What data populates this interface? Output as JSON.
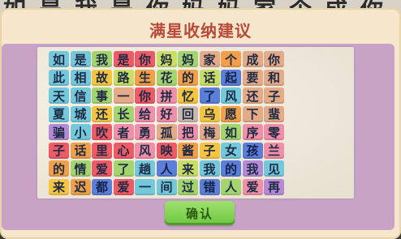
{
  "background": {
    "row_text": "如是我是你妈妈家个成你"
  },
  "dialog": {
    "title": "满星收纳建议",
    "confirm_label": "确认"
  },
  "colors": {
    "dialog_bg": "#f6e7cc",
    "title": "#b84a3a",
    "panel": "#c8a3c6",
    "button": "#7fd14d"
  },
  "board": {
    "rows": [
      [
        [
          "如",
          "cyan"
        ],
        [
          "是",
          "cyan"
        ],
        [
          "我",
          "green"
        ],
        [
          "是",
          "red"
        ],
        [
          "你",
          "red"
        ],
        [
          "妈",
          "lime"
        ],
        [
          "妈",
          "green"
        ],
        [
          "家",
          "tan"
        ],
        [
          "个",
          "orange"
        ],
        [
          "成",
          "tan"
        ],
        [
          "你",
          "tan"
        ]
      ],
      [
        [
          "此",
          "cyan"
        ],
        [
          "相",
          "cyan"
        ],
        [
          "故",
          "yellow"
        ],
        [
          "路",
          "lime"
        ],
        [
          "生",
          "orange"
        ],
        [
          "花",
          "green"
        ],
        [
          "的",
          "orange"
        ],
        [
          "话",
          "lime"
        ],
        [
          "起",
          "blue"
        ],
        [
          "要",
          "tan"
        ],
        [
          "和",
          "tan"
        ]
      ],
      [
        [
          "天",
          "cyan"
        ],
        [
          "信",
          "cyan"
        ],
        [
          "事",
          "green"
        ],
        [
          "一",
          "tan"
        ],
        [
          "你",
          "red"
        ],
        [
          "拼",
          "pink"
        ],
        [
          "忆",
          "yellow"
        ],
        [
          "了",
          "blue"
        ],
        [
          "风",
          "cyan"
        ],
        [
          "还",
          "tan"
        ],
        [
          "子",
          "tan"
        ]
      ],
      [
        [
          "夏",
          "cyan"
        ],
        [
          "城",
          "cyan"
        ],
        [
          "还",
          "yellow"
        ],
        [
          "长",
          "green"
        ],
        [
          "给",
          "pink"
        ],
        [
          "好",
          "pink"
        ],
        [
          "回",
          "gray"
        ],
        [
          "乌",
          "yellow"
        ],
        [
          "愿",
          "orange"
        ],
        [
          "下",
          "tan"
        ],
        [
          "蜚",
          "tan"
        ]
      ],
      [
        [
          "骗",
          "purple"
        ],
        [
          "小",
          "cyan"
        ],
        [
          "吹",
          "red"
        ],
        [
          "者",
          "pink"
        ],
        [
          "勇",
          "pink"
        ],
        [
          "孤",
          "tan"
        ],
        [
          "把",
          "pink"
        ],
        [
          "梅",
          "tan"
        ],
        [
          "如",
          "green"
        ],
        [
          "序",
          "pink"
        ],
        [
          "零",
          "pink"
        ]
      ],
      [
        [
          "子",
          "red"
        ],
        [
          "话",
          "orange"
        ],
        [
          "里",
          "red"
        ],
        [
          "心",
          "red"
        ],
        [
          "风",
          "pink"
        ],
        [
          "映",
          "red"
        ],
        [
          "酱",
          "orange"
        ],
        [
          "子",
          "yellow"
        ],
        [
          "女",
          "cyan"
        ],
        [
          "孩",
          "blue"
        ],
        [
          "兰",
          "pink"
        ]
      ],
      [
        [
          "的",
          "orange"
        ],
        [
          "情",
          "green"
        ],
        [
          "爱",
          "red"
        ],
        [
          "了",
          "green"
        ],
        [
          "趟",
          "cyan"
        ],
        [
          "人",
          "blue"
        ],
        [
          "来",
          "lime"
        ],
        [
          "我",
          "cyan"
        ],
        [
          "的",
          "blue"
        ],
        [
          "我",
          "purple"
        ],
        [
          "见",
          "cyan"
        ]
      ],
      [
        [
          "来",
          "yellow"
        ],
        [
          "迟",
          "orange"
        ],
        [
          "都",
          "blue"
        ],
        [
          "爱",
          "red"
        ],
        [
          "一",
          "cyan"
        ],
        [
          "间",
          "cyan"
        ],
        [
          "过",
          "green"
        ],
        [
          "错",
          "blue"
        ],
        [
          "人",
          "green"
        ],
        [
          "爱",
          "pink"
        ],
        [
          "再",
          "purple"
        ]
      ]
    ]
  }
}
